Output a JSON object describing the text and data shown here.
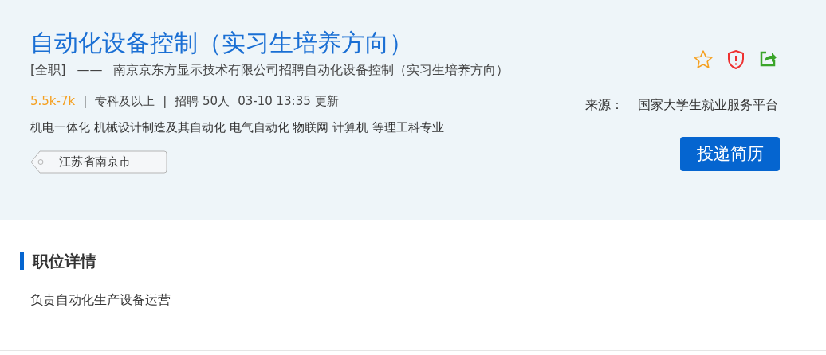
{
  "job": {
    "title": "自动化设备控制（实习生培养方向）",
    "type": "[全职]",
    "dash": "——",
    "subtitle": "南京京东方显示技术有限公司招聘自动化设备控制（实习生培养方向）",
    "salary": "5.5k-7k",
    "meta": [
      "|",
      "专科及以上",
      "|",
      "招聘 50人",
      "03-10 13:35 更新"
    ],
    "majors": "机电一体化 机械设计制造及其自动化 电气自动化 物联网 计算机 等理工科专业",
    "location": "江苏省南京市",
    "source_label": "来源：",
    "source": "国家大学生就业服务平台",
    "apply_button": "投递简历"
  },
  "details": {
    "heading": "职位详情",
    "description": "负责自动化生产设备运营"
  }
}
